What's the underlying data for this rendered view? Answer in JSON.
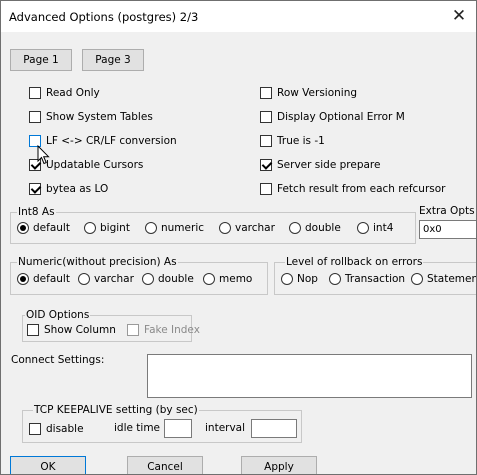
{
  "window": {
    "title": "Advanced Options (postgres) 2/3",
    "close_glyph": "✕"
  },
  "nav": {
    "page1": "Page 1",
    "page3": "Page 3"
  },
  "checkboxes": {
    "read_only": {
      "label": "Read Only",
      "checked": false
    },
    "show_system_tables": {
      "label": "Show System Tables",
      "checked": false
    },
    "lf_conversion": {
      "label": "LF <-> CR/LF conversion",
      "checked": false
    },
    "updatable_cursors": {
      "label": "Updatable Cursors",
      "checked": true
    },
    "bytea_as_lo": {
      "label": "bytea as LO",
      "checked": true
    },
    "row_versioning": {
      "label": "Row Versioning",
      "checked": false
    },
    "display_optional_error": {
      "label": "Display Optional Error M",
      "checked": false
    },
    "true_is_minus1": {
      "label": "True is -1",
      "checked": false
    },
    "server_side_prepare": {
      "label": "Server side prepare",
      "checked": true
    },
    "fetch_result": {
      "label": "Fetch result from each refcursor",
      "checked": false
    }
  },
  "int8": {
    "title": "Int8 As",
    "options": [
      "default",
      "bigint",
      "numeric",
      "varchar",
      "double",
      "int4"
    ],
    "selected": "default"
  },
  "extra_opts": {
    "label": "Extra Opts",
    "value": "0x0"
  },
  "numeric": {
    "title": "Numeric(without precision) As",
    "options": [
      "default",
      "varchar",
      "double",
      "memo"
    ],
    "selected": "default"
  },
  "rollback": {
    "title": "Level of rollback on errors",
    "options": [
      "Nop",
      "Transaction",
      "Statement"
    ],
    "selected": ""
  },
  "oid": {
    "title": "OID Options",
    "show_column": {
      "label": "Show Column",
      "checked": false
    },
    "fake_index": {
      "label": "Fake Index",
      "checked": false
    }
  },
  "connect_settings": {
    "label": "Connect Settings:",
    "value": ""
  },
  "keepalive": {
    "title": "TCP KEEPALIVE setting (by sec)",
    "disable": {
      "label": "disable",
      "checked": false
    },
    "idle_label": "idle time",
    "idle_value": "",
    "interval_label": "interval",
    "interval_value": ""
  },
  "buttons": {
    "ok": "OK",
    "cancel": "Cancel",
    "apply": "Apply"
  }
}
